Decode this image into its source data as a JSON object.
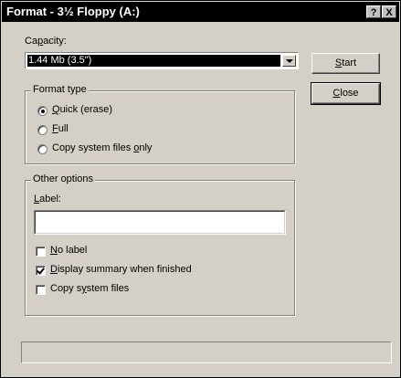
{
  "window": {
    "title": "Format - 3½ Floppy (A:)",
    "help_button": "?",
    "close_button": "X"
  },
  "capacity": {
    "label": "Capacity:",
    "selected": "1.44 Mb (3.5\")"
  },
  "buttons": {
    "start": "Start",
    "close": "Close"
  },
  "format_type": {
    "title": "Format type",
    "options": [
      {
        "label": "Quick (erase)",
        "checked": true
      },
      {
        "label": "Full",
        "checked": false
      },
      {
        "label": "Copy system files only",
        "checked": false
      }
    ]
  },
  "other_options": {
    "title": "Other options",
    "label_caption": "Label:",
    "label_value": "",
    "checkboxes": [
      {
        "label": "No label",
        "checked": false
      },
      {
        "label": "Display summary when finished",
        "checked": true
      },
      {
        "label": "Copy system files",
        "checked": false
      }
    ]
  },
  "status_bar": {
    "text": ""
  }
}
